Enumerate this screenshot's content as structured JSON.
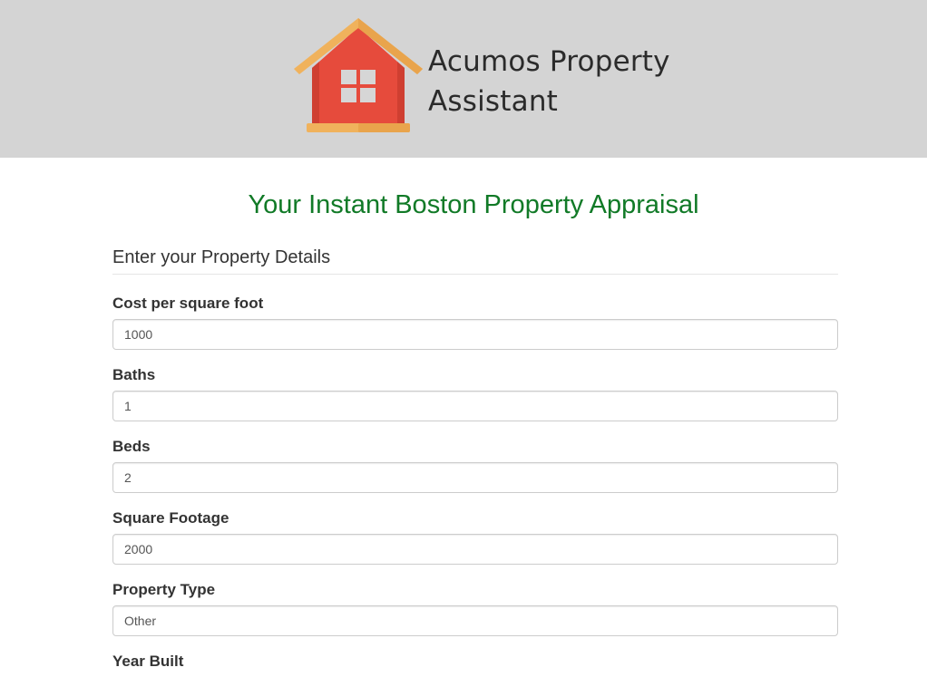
{
  "header": {
    "brand_line1": "Acumos Property",
    "brand_line2": "Assistant",
    "background": "#d4d4d4",
    "logo_icon": "house-icon"
  },
  "main": {
    "title": "Your Instant Boston Property Appraisal",
    "title_color": "#117a27",
    "section_title": "Enter your Property Details"
  },
  "fields": [
    {
      "label": "Cost per square foot",
      "value": "1000"
    },
    {
      "label": "Baths",
      "value": "1"
    },
    {
      "label": "Beds",
      "value": "2"
    },
    {
      "label": "Square Footage",
      "value": "2000"
    },
    {
      "label": "Property Type",
      "value": "Other"
    },
    {
      "label": "Year Built"
    }
  ]
}
